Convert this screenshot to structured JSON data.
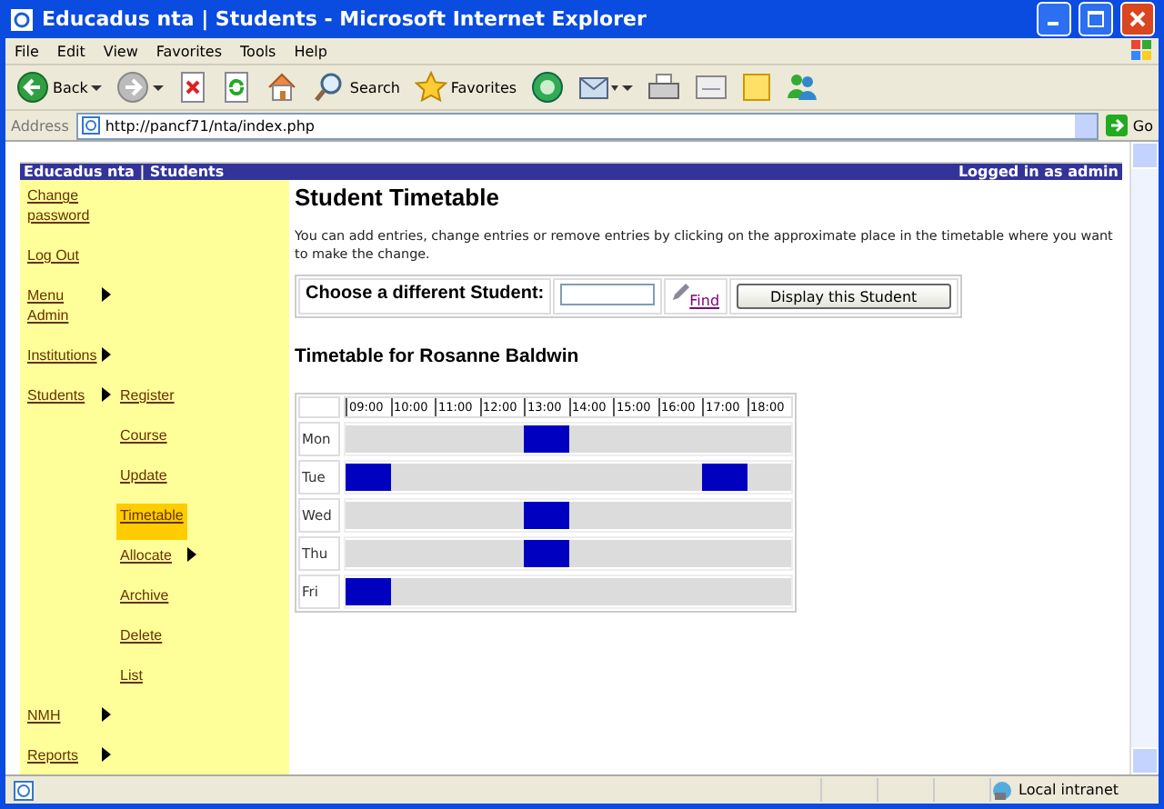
{
  "window": {
    "title": "Educadus nta | Students - Microsoft Internet Explorer"
  },
  "menu_bar": [
    "File",
    "Edit",
    "View",
    "Favorites",
    "Tools",
    "Help"
  ],
  "toolbar": [
    {
      "kind": "back",
      "label": "Back"
    },
    {
      "kind": "forward"
    },
    {
      "kind": "stop"
    },
    {
      "kind": "refresh"
    },
    {
      "kind": "home"
    },
    {
      "kind": "search",
      "label": "Search"
    },
    {
      "kind": "favorites",
      "label": "Favorites"
    },
    {
      "kind": "media"
    },
    {
      "kind": "mail"
    },
    {
      "kind": "print"
    },
    {
      "kind": "edit"
    },
    {
      "kind": "discuss"
    },
    {
      "kind": "messenger"
    }
  ],
  "address_bar": {
    "label": "Address",
    "value": "http://pancf71/nta/index.php",
    "go": "Go"
  },
  "page": {
    "site_title": "Educadus nta | Students",
    "login_status": "Logged in as admin",
    "sidebar": [
      {
        "label": "Change password",
        "has_submenu": false,
        "selected": false
      },
      {
        "label": "Log Out",
        "has_submenu": false,
        "selected": false
      },
      {
        "label": "Menu Admin",
        "has_submenu": true,
        "selected": false
      },
      {
        "label": "Institutions",
        "has_submenu": true,
        "selected": false
      },
      {
        "label": "Students",
        "has_submenu": true,
        "selected": false,
        "children": [
          {
            "label": "Register",
            "has_submenu": false,
            "selected": false
          },
          {
            "label": "Course",
            "has_submenu": false,
            "selected": false
          },
          {
            "label": "Update",
            "has_submenu": false,
            "selected": false
          },
          {
            "label": "Timetable",
            "has_submenu": false,
            "selected": true
          },
          {
            "label": "Allocate",
            "has_submenu": true,
            "selected": false
          },
          {
            "label": "Archive",
            "has_submenu": false,
            "selected": false
          },
          {
            "label": "Delete",
            "has_submenu": false,
            "selected": false
          },
          {
            "label": "List",
            "has_submenu": false,
            "selected": false
          }
        ]
      },
      {
        "label": "NMH",
        "has_submenu": true,
        "selected": false
      },
      {
        "label": "Reports",
        "has_submenu": true,
        "selected": false
      }
    ],
    "heading": "Student Timetable",
    "intro": "You can add entries, change entries or remove entries by clicking on the approximate place in the timetable where you want to make the change.",
    "student_picker": {
      "label": "Choose a different Student:",
      "find": "Find",
      "button": "Display this Student"
    },
    "timetable": {
      "title": "Timetable for Rosanne Baldwin",
      "hours": [
        "09:00",
        "10:00",
        "11:00",
        "12:00",
        "13:00",
        "14:00",
        "15:00",
        "16:00",
        "17:00",
        "18:00"
      ],
      "days": [
        {
          "label": "Mon",
          "booked": [
            false,
            false,
            false,
            false,
            true,
            false,
            false,
            false,
            false,
            false
          ]
        },
        {
          "label": "Tue",
          "booked": [
            true,
            false,
            false,
            false,
            false,
            false,
            false,
            false,
            true,
            false
          ]
        },
        {
          "label": "Wed",
          "booked": [
            false,
            false,
            false,
            false,
            true,
            false,
            false,
            false,
            false,
            false
          ]
        },
        {
          "label": "Thu",
          "booked": [
            false,
            false,
            false,
            false,
            true,
            false,
            false,
            false,
            false,
            false
          ]
        },
        {
          "label": "Fri",
          "booked": [
            true,
            false,
            false,
            false,
            false,
            false,
            false,
            false,
            false,
            false
          ]
        }
      ]
    }
  },
  "status_bar": {
    "zone": "Local intranet"
  }
}
